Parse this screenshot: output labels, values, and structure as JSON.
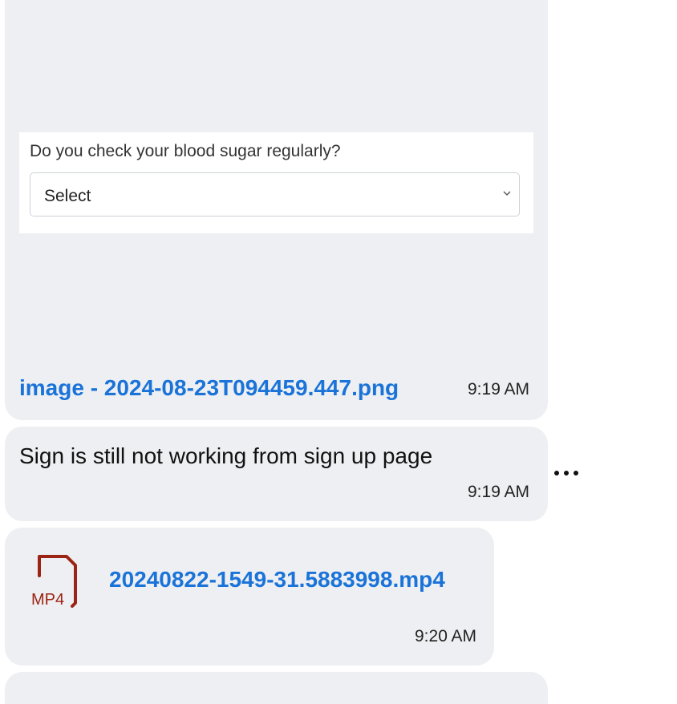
{
  "messages": {
    "image_msg": {
      "screenshot_question": "Do you check your blood sugar regularly?",
      "screenshot_select_value": "Select",
      "file_name": "image - 2024-08-23T094459.447.png",
      "time": "9:19 AM"
    },
    "text_msg": {
      "text": "Sign is still not working from sign up page",
      "time": "9:19 AM"
    },
    "video_msg": {
      "file_badge": "MP4",
      "file_name": "20240822-1549-31.5883998.mp4",
      "time": "9:20 AM"
    }
  },
  "icons": {
    "more": "more-horizontal-icon",
    "file": "mp4-file-icon"
  },
  "colors": {
    "bubble": "#eeeff2",
    "link": "#1a73d8",
    "file_icon": "#9b2414"
  }
}
